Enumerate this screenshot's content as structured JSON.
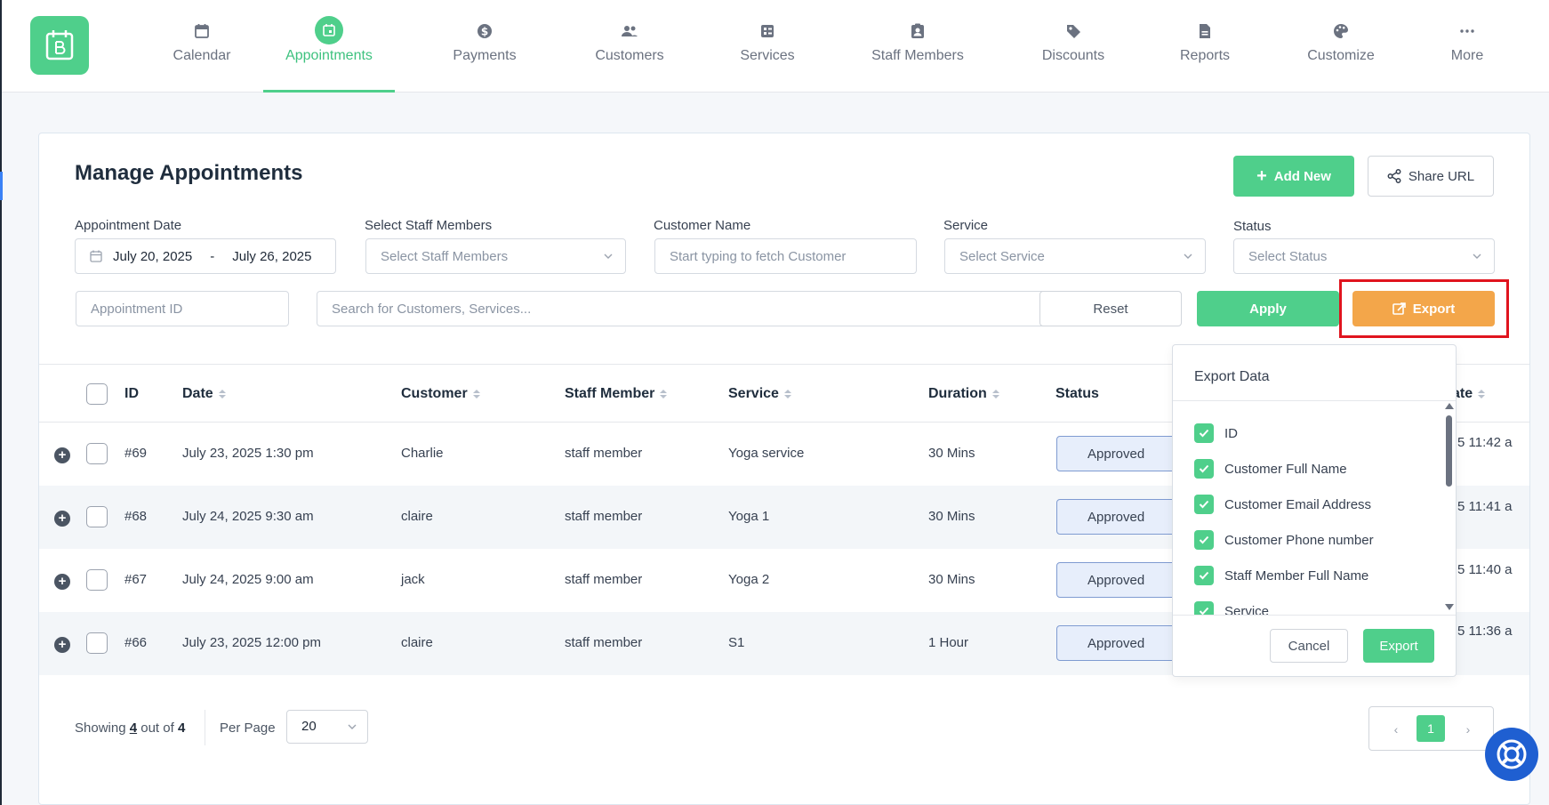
{
  "nav": {
    "items": [
      {
        "label": "Calendar",
        "icon": "calendar-icon"
      },
      {
        "label": "Appointments",
        "icon": "appointments-icon",
        "active": true
      },
      {
        "label": "Payments",
        "icon": "dollar-icon"
      },
      {
        "label": "Customers",
        "icon": "users-icon"
      },
      {
        "label": "Services",
        "icon": "services-icon"
      },
      {
        "label": "Staff Members",
        "icon": "id-badge-icon"
      },
      {
        "label": "Discounts",
        "icon": "tag-icon"
      },
      {
        "label": "Reports",
        "icon": "file-icon"
      },
      {
        "label": "Customize",
        "icon": "palette-icon"
      },
      {
        "label": "More",
        "icon": "ellipsis-icon"
      }
    ]
  },
  "page": {
    "title": "Manage Appointments",
    "add_new": "Add New",
    "share_url": "Share URL"
  },
  "filters": {
    "date_label": "Appointment Date",
    "date_from": "July 20, 2025",
    "date_sep": "-",
    "date_to": "July 26, 2025",
    "staff_label": "Select Staff Members",
    "staff_placeholder": "Select Staff Members",
    "customer_label": "Customer Name",
    "customer_placeholder": "Start typing to fetch Customer",
    "service_label": "Service",
    "service_placeholder": "Select Service",
    "status_label": "Status",
    "status_placeholder": "Select Status",
    "appointment_id_placeholder": "Appointment ID",
    "search_placeholder": "Search for Customers, Services...",
    "reset": "Reset",
    "apply": "Apply",
    "export": "Export"
  },
  "table": {
    "headers": {
      "id": "ID",
      "date": "Date",
      "customer": "Customer",
      "staff": "Staff Member",
      "service": "Service",
      "duration": "Duration",
      "status": "Status",
      "created": "ate"
    },
    "rows": [
      {
        "id": "#69",
        "date": "July 23, 2025 1:30 pm",
        "customer": "Charlie",
        "staff": "staff member",
        "service": "Yoga service",
        "duration": "30 Mins",
        "status": "Approved",
        "created": "5 11:42 a"
      },
      {
        "id": "#68",
        "date": "July 24, 2025 9:30 am",
        "customer": "claire",
        "staff": "staff member",
        "service": "Yoga 1",
        "duration": "30 Mins",
        "status": "Approved",
        "created": "5 11:41 a"
      },
      {
        "id": "#67",
        "date": "July 24, 2025 9:00 am",
        "customer": "jack",
        "staff": "staff member",
        "service": "Yoga 2",
        "duration": "30 Mins",
        "status": "Approved",
        "created": "5 11:40 a"
      },
      {
        "id": "#66",
        "date": "July 23, 2025 12:00 pm",
        "customer": "claire",
        "staff": "staff member",
        "service": "S1",
        "duration": "1 Hour",
        "status": "Approved",
        "created": "5 11:36 a"
      }
    ]
  },
  "footer": {
    "showing_prefix": "Showing",
    "showing_count": "4",
    "showing_mid": "out of",
    "showing_total": "4",
    "per_page_label": "Per Page",
    "per_page_value": "20",
    "prev": "‹",
    "current_page": "1",
    "next": "›"
  },
  "export_popup": {
    "title": "Export Data",
    "fields": [
      "ID",
      "Customer Full Name",
      "Customer Email Address",
      "Customer Phone number",
      "Staff Member Full Name",
      "Service"
    ],
    "cancel": "Cancel",
    "export": "Export"
  },
  "colors": {
    "accent_green": "#4fcf8b",
    "export_orange": "#f3a64a",
    "highlight_red": "#e0141e",
    "help_blue": "#1f5fd1"
  }
}
